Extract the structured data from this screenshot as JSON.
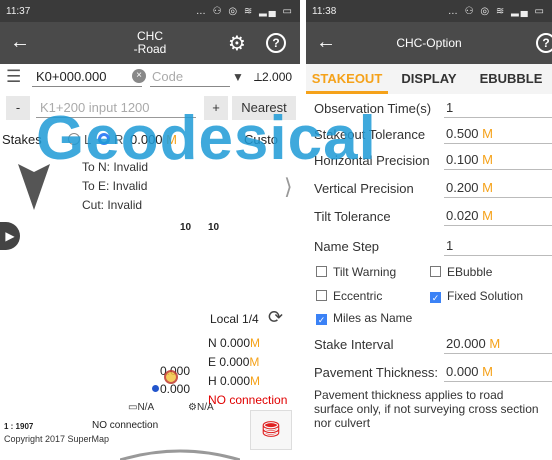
{
  "left": {
    "status_time": "11:37",
    "app_title_1": "CHC",
    "app_title_2": "-Road",
    "station": "K0+000.000",
    "code_placeholder": "Code",
    "pole_height": "2.000",
    "minus": "-",
    "station_input_placeholder": "K1+200 input 1200",
    "plus": "+",
    "nearest": "Nearest",
    "stakes_label": "Stakes",
    "opt_l": "L",
    "opt_r": "R",
    "offset": "0.000",
    "unit": "M",
    "custom": "Custo",
    "to_n": "To N: Invalid",
    "to_e": "To E: Invalid",
    "cut": "Cut: Invalid",
    "map_label_1": "10",
    "map_label_2": "10",
    "local": "Local 1/4",
    "n_label": "N 0.000",
    "e_label": "E 0.000",
    "h_label": "H 0.000",
    "no_connection": "NO connection",
    "pt_a": "0.000",
    "pt_b": "0.000",
    "na_1": "N/A",
    "na_2": "N/A",
    "scale": "1 : 1907",
    "no_connection_small": "NO connection",
    "copyright": "Copyright 2017 SuperMap"
  },
  "watermark": "Geodesical",
  "right": {
    "status_time": "11:38",
    "title": "CHC-Option",
    "tabs": [
      "STAKEOUT",
      "DISPLAY",
      "EBUBBLE"
    ],
    "fields": [
      {
        "label": "Observation Time(s)",
        "value": "1",
        "unit": ""
      },
      {
        "label": "Stakeout Tolerance",
        "value": "0.500",
        "unit": "M"
      },
      {
        "label": "Horizontal Precision",
        "value": "0.100",
        "unit": "M"
      },
      {
        "label": "Vertical Precision",
        "value": "0.200",
        "unit": "M"
      },
      {
        "label": "Tilt Tolerance",
        "value": "0.020",
        "unit": "M"
      },
      {
        "label": "Name Step",
        "value": "1",
        "unit": ""
      }
    ],
    "checks": {
      "tilt_warning": "Tilt Warning",
      "ebubble": "EBubble",
      "eccentric": "Eccentric",
      "fixed_solution": "Fixed Solution",
      "miles_as_name": "Miles as Name"
    },
    "stake_interval_label": "Stake Interval",
    "stake_interval_value": "20.000",
    "pavement_label": "Pavement Thickness:",
    "pavement_value": "0.000",
    "note": "Pavement thickness applies to road surface only, if not surveying cross section nor culvert",
    "unit": "M"
  }
}
